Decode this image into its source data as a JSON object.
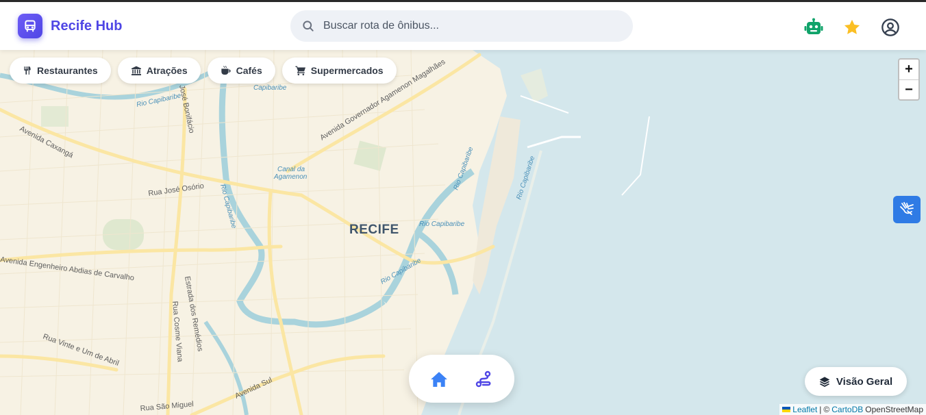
{
  "header": {
    "app_title": "Recife Hub",
    "logo_icon": "bus-icon",
    "search_placeholder": "Buscar rota de ônibus...",
    "icons": [
      "robot-icon",
      "star-icon",
      "user-circle-icon"
    ],
    "colors": {
      "brand": "#4f46e5",
      "robot": "#10a36a",
      "star": "#fbbf24"
    }
  },
  "filters": [
    {
      "label": "Restaurantes",
      "icon": "utensils-icon"
    },
    {
      "label": "Atrações",
      "icon": "landmark-icon"
    },
    {
      "label": "Cafés",
      "icon": "coffee-icon"
    },
    {
      "label": "Supermercados",
      "icon": "cart-icon"
    }
  ],
  "map": {
    "city_label": "RECIFE",
    "zoom_in": "+",
    "zoom_out": "−",
    "street_labels": [
      "Avenida Governador Agamenon Magalhães",
      "José Bonifácio",
      "Avenida Caxangá",
      "Rua José Osório",
      "Canal da",
      "Agamenon",
      "Rio Capibaribe",
      "Rio Capibaribe",
      "Rio Capibaribe",
      "Rio Capibaribe",
      "Rio Capibaribe",
      "Rio Capibaribe",
      "Avenida Engenheiro Abdias de Carvalho",
      "Estrada dos Remédios",
      "Rua Cosme Viana",
      "Rua Vinte e Um de Abril",
      "Avenida Sul",
      "Rua São Miguel",
      "Capibaribe"
    ],
    "colors": {
      "sea": "#d4e7ec",
      "land": "#f7f2e4",
      "road": "#fbe6a3",
      "water_label": "#4a90b8"
    }
  },
  "accessibility_icon": "sign-language-icon",
  "bottom_nav": {
    "home_icon": "home-icon",
    "route_icon": "route-icon",
    "active_color": "#3b82f6"
  },
  "overview": {
    "label": "Visão Geral",
    "icon": "layers-icon"
  },
  "attribution": {
    "leaflet": "Leaflet",
    "separator": "|",
    "copyright": "©",
    "carto": "CartoDB",
    "osm": "OpenStreetMap"
  }
}
